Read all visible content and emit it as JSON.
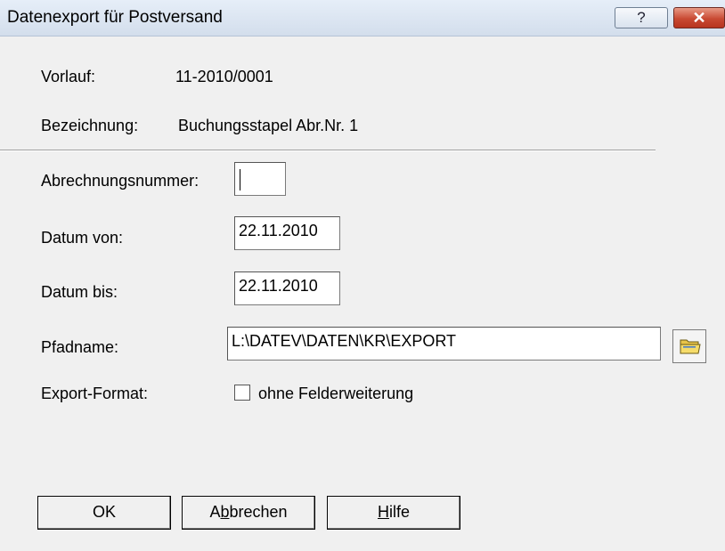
{
  "window": {
    "title": "Datenexport für Postversand",
    "help_label": "?",
    "close_label": "✕"
  },
  "info": {
    "vorlauf_label": "Vorlauf:",
    "vorlauf_value": "11-2010/0001",
    "bezeichnung_label": "Bezeichnung:",
    "bezeichnung_value": "Buchungsstapel Abr.Nr. 1"
  },
  "form": {
    "abrechnungsnummer_label": "Abrechnungsnummer:",
    "abrechnungsnummer_value": "",
    "datum_von_label": "Datum von:",
    "datum_von_value": "22.11.2010",
    "datum_bis_label": "Datum bis:",
    "datum_bis_value": "22.11.2010",
    "pfadname_label": "Pfadname:",
    "pfadname_value": "L:\\DATEV\\DATEN\\KR\\EXPORT",
    "export_format_label": "Export-Format:",
    "ohne_felderweiterung_label": "ohne Felderweiterung",
    "ohne_felderweiterung_checked": false
  },
  "buttons": {
    "ok": "OK",
    "abbrechen_pre": "A",
    "abbrechen_ul": "b",
    "abbrechen_post": "brechen",
    "hilfe_ul": "H",
    "hilfe_post": "ilfe"
  },
  "icons": {
    "folder": "folder-icon",
    "help": "help-icon",
    "close": "close-icon"
  }
}
